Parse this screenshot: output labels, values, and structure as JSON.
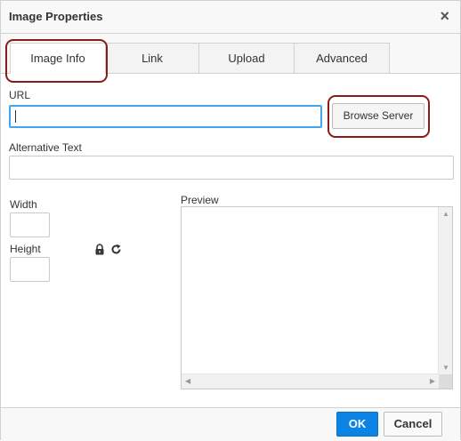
{
  "dialog": {
    "title": "Image Properties",
    "close_glyph": "×"
  },
  "tabs": [
    {
      "label": "Image Info",
      "active": true
    },
    {
      "label": "Link",
      "active": false
    },
    {
      "label": "Upload",
      "active": false
    },
    {
      "label": "Advanced",
      "active": false
    }
  ],
  "form": {
    "url_label": "URL",
    "url_value": "",
    "browse_label": "Browse Server",
    "alt_label": "Alternative Text",
    "alt_value": "",
    "width_label": "Width",
    "width_value": "",
    "height_label": "Height",
    "height_value": "",
    "preview_label": "Preview"
  },
  "icons": {
    "lock": "lock-icon",
    "reset": "reset-size-icon"
  },
  "footer": {
    "ok_label": "OK",
    "cancel_label": "Cancel"
  },
  "colors": {
    "accent": "#0b84e5",
    "highlight": "#8b1a1a",
    "focus": "#3ea6f0"
  }
}
